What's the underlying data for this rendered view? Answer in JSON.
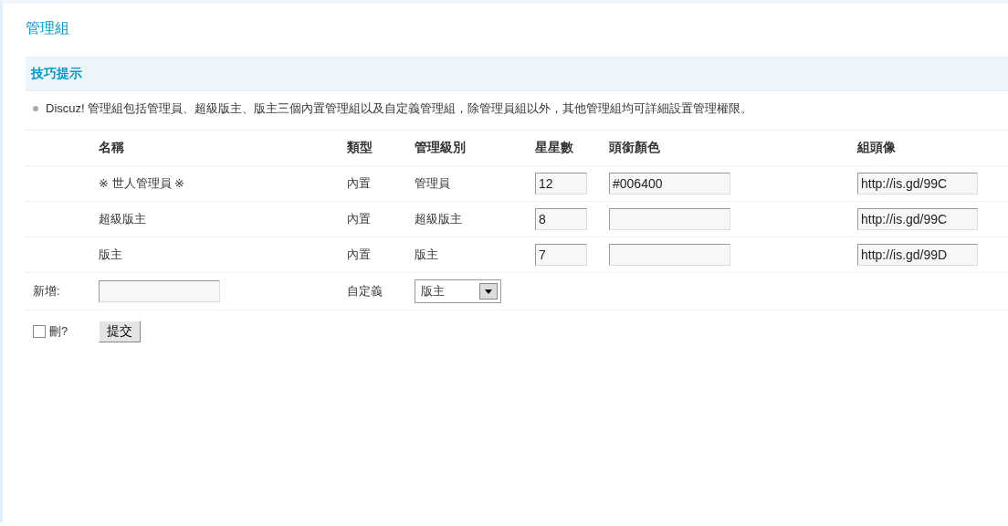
{
  "page_title": "管理組",
  "tips": {
    "title": "技巧提示",
    "items": [
      "Discuz! 管理組包括管理員、超級版主、版主三個內置管理組以及自定義管理組，除管理員組以外，其他管理組均可詳細設置管理權限。"
    ]
  },
  "table": {
    "columns": [
      "名稱",
      "類型",
      "管理級別",
      "星星數",
      "頭銜顏色",
      "組頭像"
    ],
    "rows": [
      {
        "name": "※ 世人管理員 ※",
        "type": "內置",
        "level": "管理員",
        "stars": "12",
        "title_color": "#006400",
        "avatar": "http://is.gd/99C"
      },
      {
        "name": "超級版主",
        "type": "內置",
        "level": "超級版主",
        "stars": "8",
        "avatar": "http://is.gd/99C"
      },
      {
        "name": "版主",
        "type": "內置",
        "level": "版主",
        "stars": "7",
        "avatar": "http://is.gd/99D"
      }
    ]
  },
  "add_row": {
    "label": "新增:",
    "type": "自定義",
    "level_select": "版主"
  },
  "footer": {
    "delete": {
      "label": "刪?",
      "checked": false
    },
    "submit": "提交"
  }
}
